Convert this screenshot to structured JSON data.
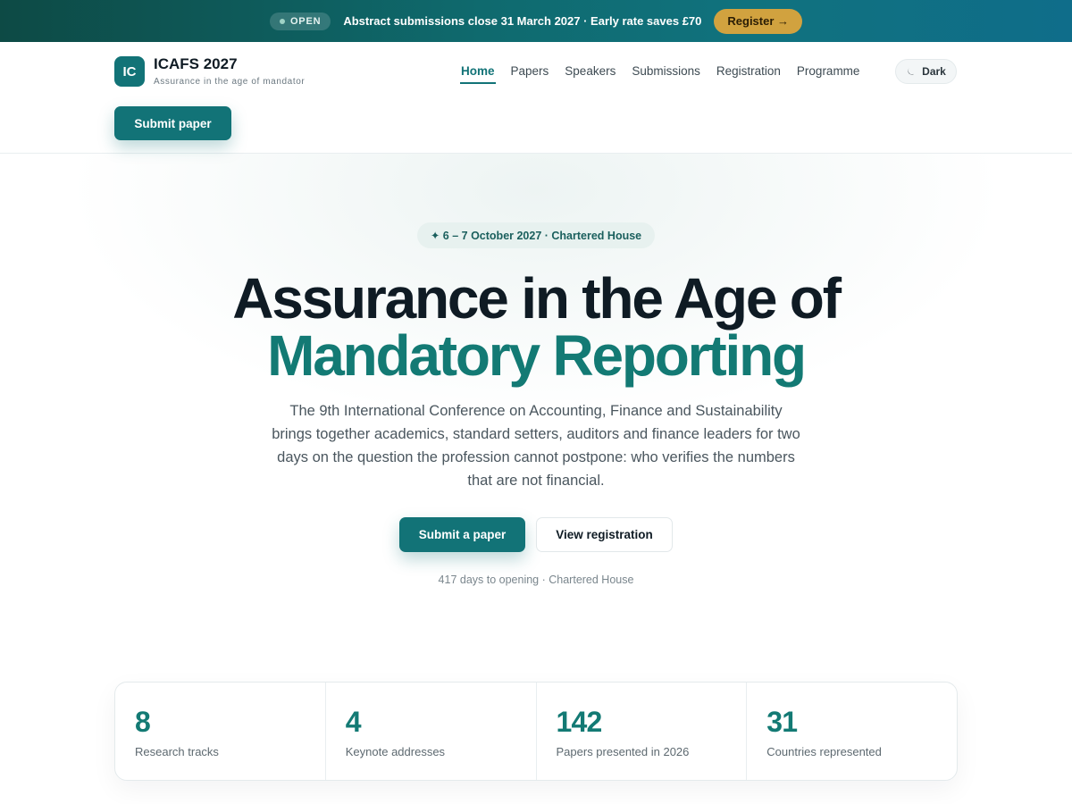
{
  "announcement": {
    "badge": "OPEN",
    "text": "Abstract submissions close 31 March 2027 · Early rate saves £70",
    "cta": "Register →"
  },
  "header": {
    "logo_initials": "IC",
    "brand_name": "ICAFS 2027",
    "brand_tagline": "Assurance in the age of mandator",
    "nav": [
      "Home",
      "Papers",
      "Speakers",
      "Submissions",
      "Registration",
      "Programme"
    ],
    "active_nav": "Home",
    "theme_toggle": "Dark",
    "theme_icon": "moon-icon",
    "submit_button": "Submit paper"
  },
  "hero": {
    "date_pill": "✦ 6 – 7 October 2027 · Chartered House",
    "title_line1": "Assurance in the Age of",
    "title_line2": "Mandatory Reporting",
    "description": "The 9th International Conference on Accounting, Finance and Sustainability brings together academics, standard setters, auditors and finance leaders for two days on the question the profession cannot postpone: who verifies the numbers that are not financial.",
    "primary_cta": "Submit a paper",
    "secondary_cta": "View registration",
    "countdown": "417 days to opening · Chartered House"
  },
  "stats": [
    {
      "value": "8",
      "label": "Research tracks"
    },
    {
      "value": "4",
      "label": "Keynote addresses"
    },
    {
      "value": "142",
      "label": "Papers presented in 2026"
    },
    {
      "value": "31",
      "label": "Countries represented"
    }
  ],
  "colors": {
    "brand": "#127377",
    "accent": "#d1a23f",
    "text": "#0f1b24"
  }
}
